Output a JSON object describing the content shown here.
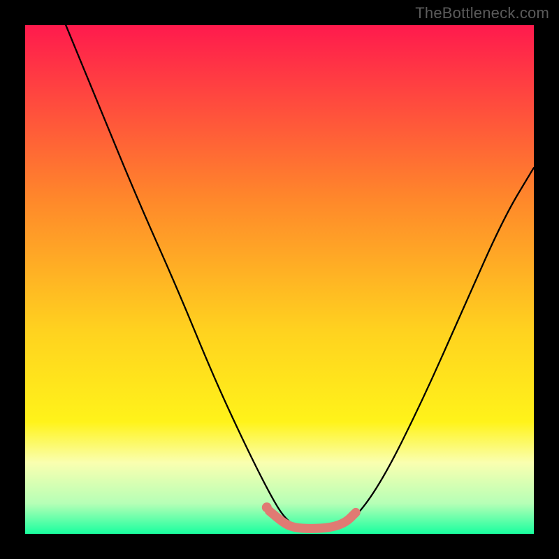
{
  "watermark": "TheBottleneck.com",
  "chart_data": {
    "type": "line",
    "title": "",
    "xlabel": "",
    "ylabel": "",
    "xlim": [
      0,
      100
    ],
    "ylim": [
      0,
      100
    ],
    "grid": false,
    "legend": false,
    "gradient_stops": [
      {
        "pos": 0,
        "color": "#ff1a4d"
      },
      {
        "pos": 35,
        "color": "#ff8a2a"
      },
      {
        "pos": 60,
        "color": "#ffd21f"
      },
      {
        "pos": 78,
        "color": "#fff31a"
      },
      {
        "pos": 86,
        "color": "#faffb0"
      },
      {
        "pos": 94,
        "color": "#b6ffb6"
      },
      {
        "pos": 100,
        "color": "#19ff9f"
      }
    ],
    "series": [
      {
        "name": "bottleneck-curve",
        "color": "#000000",
        "x": [
          8,
          15,
          22,
          30,
          37,
          43,
          48,
          51,
          54,
          56,
          60,
          64,
          70,
          78,
          86,
          94,
          100
        ],
        "y": [
          100,
          83,
          66,
          48,
          31,
          18,
          8,
          3,
          1,
          0.5,
          0.5,
          2,
          10,
          26,
          44,
          62,
          72
        ]
      },
      {
        "name": "highlight-band",
        "color": "#e07a73",
        "x": [
          48,
          51,
          53,
          56,
          60,
          63,
          65
        ],
        "y": [
          4.5,
          2.0,
          1.2,
          1.0,
          1.2,
          2.2,
          4.2
        ]
      }
    ],
    "highlight_dot": {
      "x": 47.5,
      "y": 5.2,
      "color": "#e07a73"
    }
  }
}
